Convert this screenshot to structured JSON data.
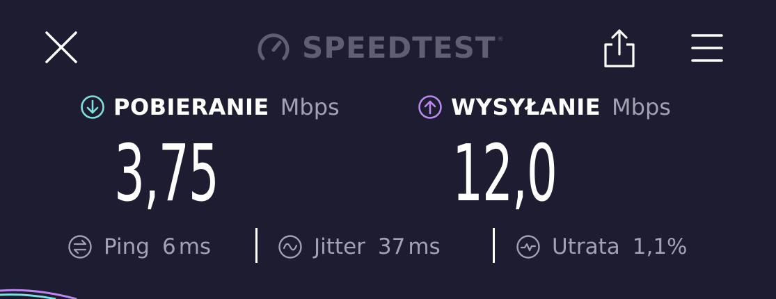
{
  "header": {
    "logo_text": "SPEEDTEST",
    "logo_mark": "®",
    "close_icon": "close-icon",
    "share_icon": "share-icon",
    "menu_icon": "hamburger-menu-icon"
  },
  "download": {
    "label": "POBIERANIE",
    "unit": "Mbps",
    "value": "3,75",
    "icon": "download-arrow-icon",
    "color": "#7ee0e0"
  },
  "upload": {
    "label": "WYSYŁANIE",
    "unit": "Mbps",
    "value": "12,0",
    "icon": "upload-arrow-icon",
    "color": "#bb88f0"
  },
  "stats": {
    "ping": {
      "label": "Ping",
      "value": "6",
      "unit": "ms",
      "icon": "ping-icon"
    },
    "jitter": {
      "label": "Jitter",
      "value": "37",
      "unit": "ms",
      "icon": "jitter-icon"
    },
    "loss": {
      "label": "Utrata",
      "value": "1,1%",
      "icon": "packet-loss-icon"
    }
  },
  "colors": {
    "background": "#1d1c30",
    "muted_text": "#a3a2b5",
    "logo": "#5f5e72"
  }
}
